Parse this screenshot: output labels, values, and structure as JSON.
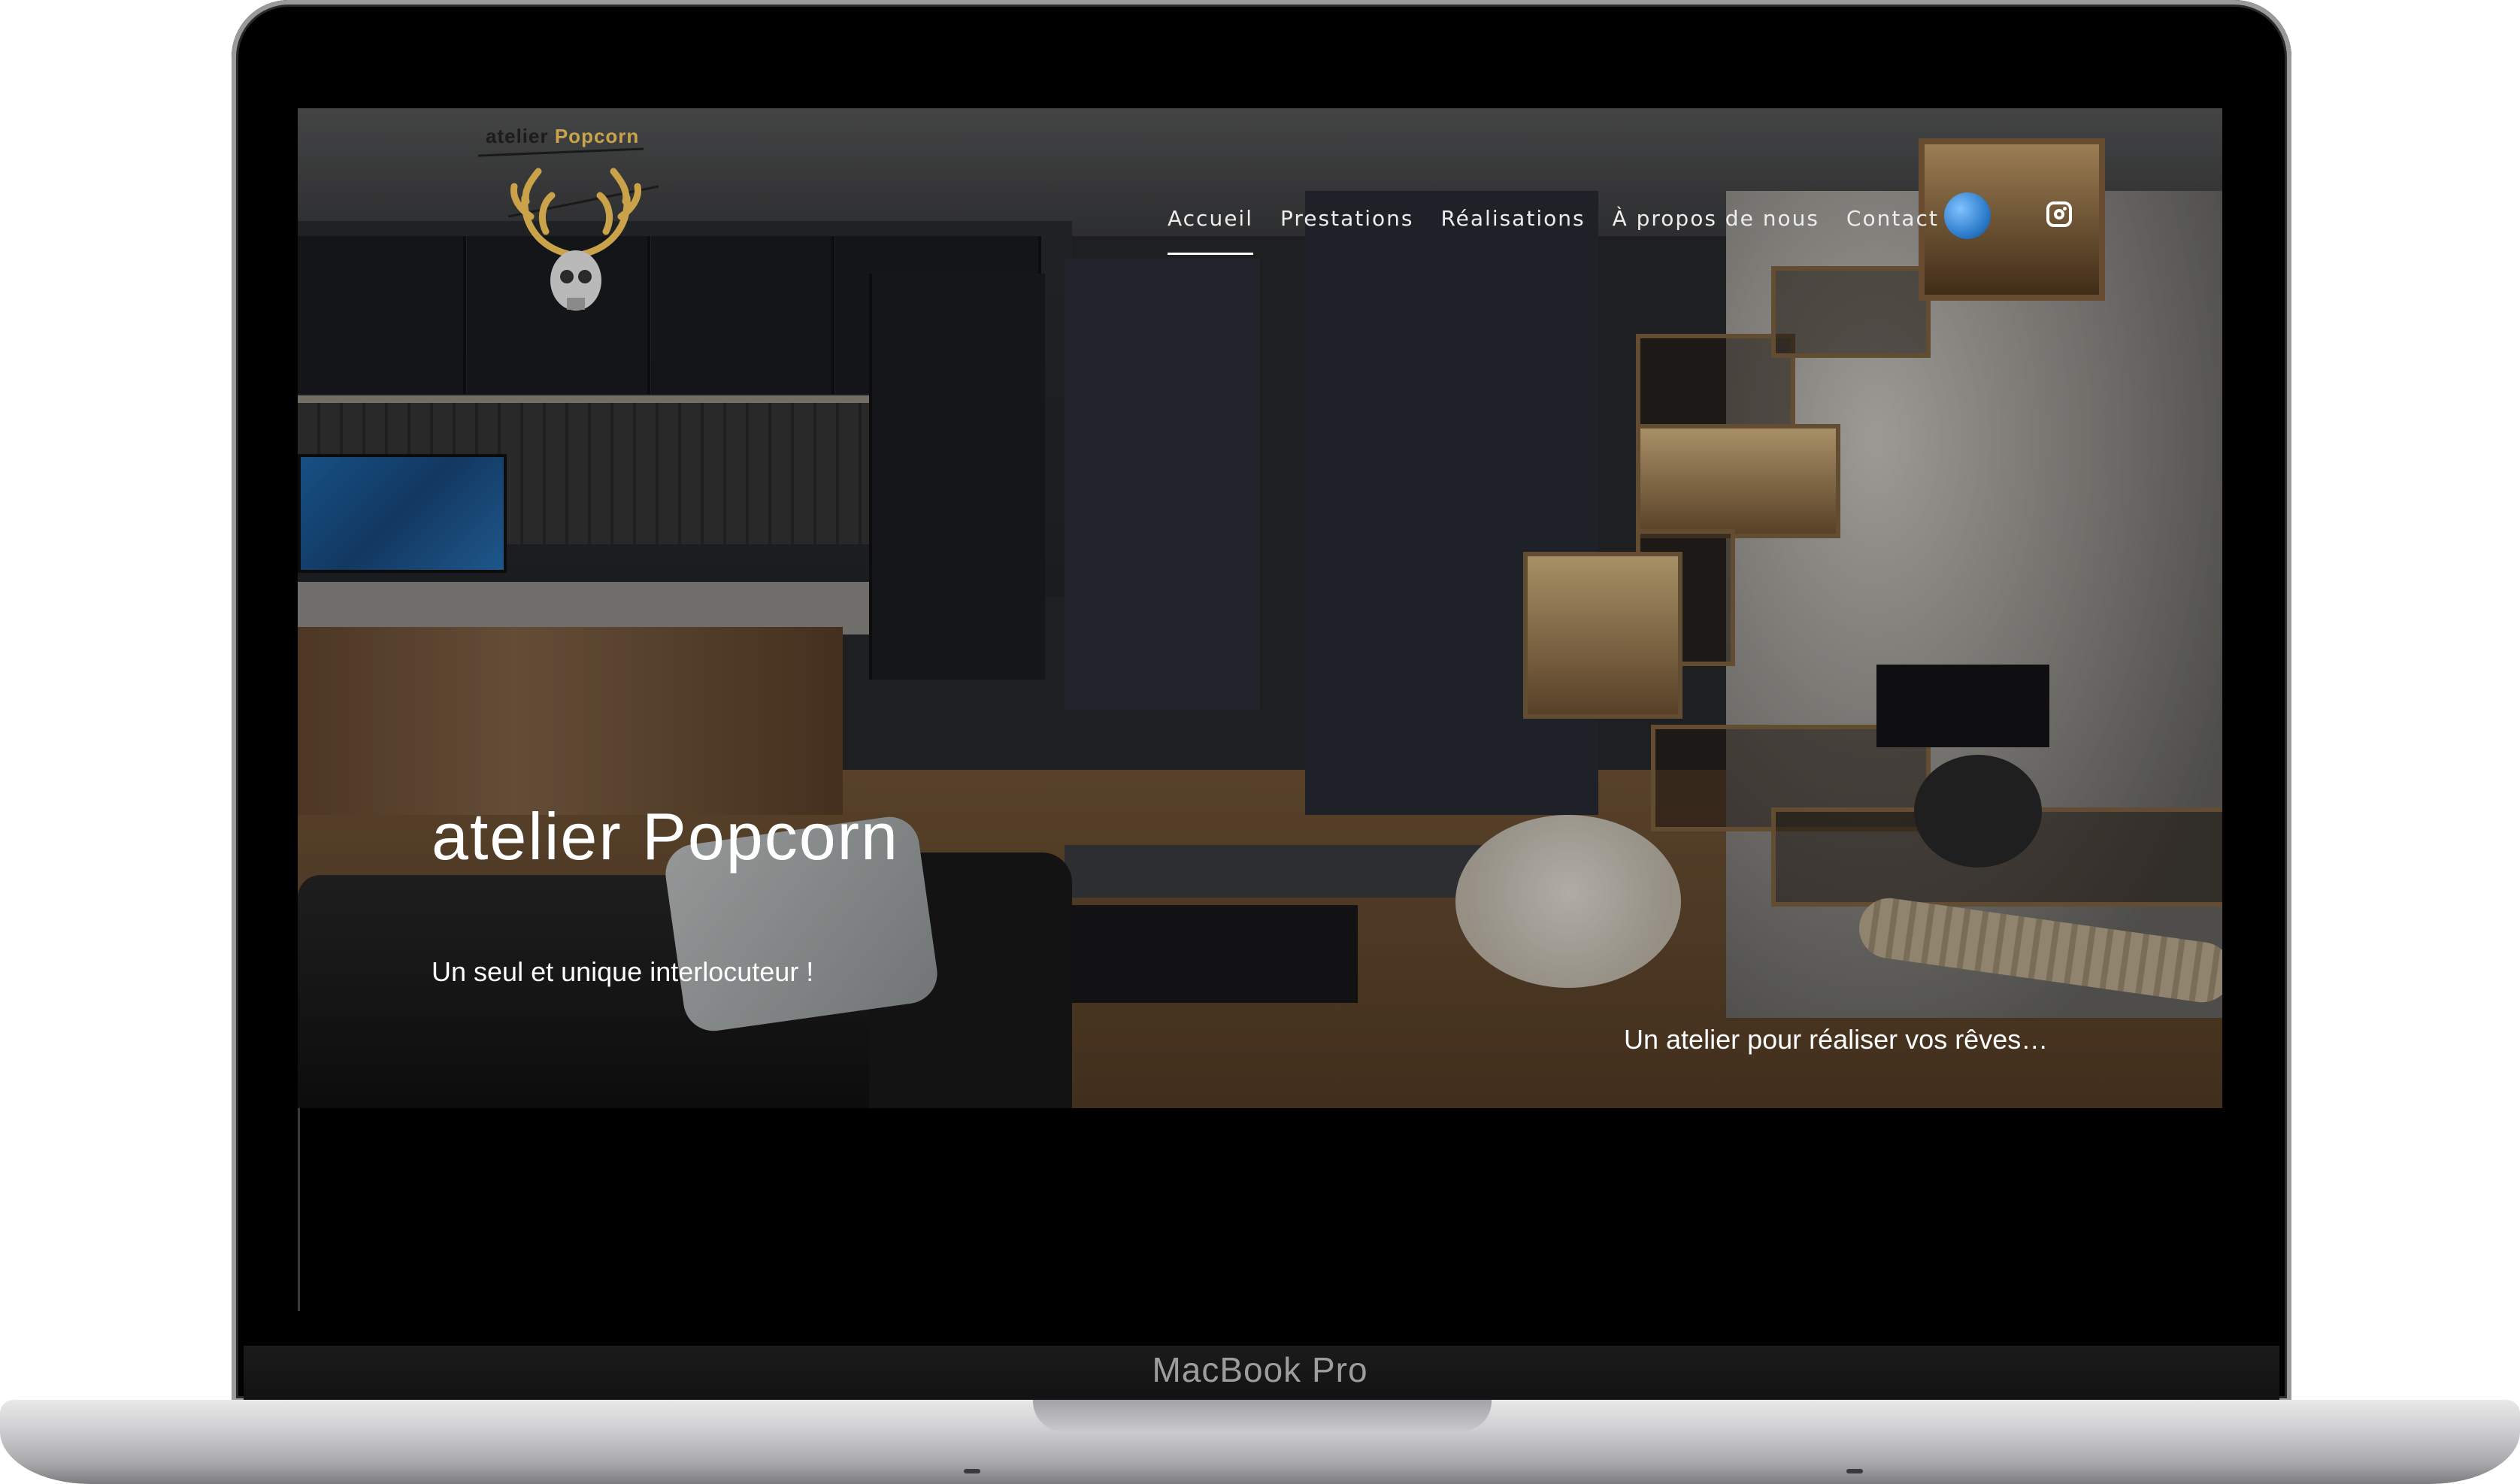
{
  "device": {
    "model_label": "MacBook Pro"
  },
  "site": {
    "logo_text_primary": "atelier",
    "logo_text_accent": "Popcorn",
    "nav": [
      {
        "label": "Accueil",
        "active": true
      },
      {
        "label": "Prestations",
        "active": false
      },
      {
        "label": "Réalisations",
        "active": false
      },
      {
        "label": "À propos de nous",
        "active": false
      },
      {
        "label": "Contact",
        "active": false
      }
    ],
    "icons": {
      "globe": "globe-icon",
      "instagram": "instagram-icon"
    }
  },
  "hero": {
    "title": "atelier Popcorn",
    "subtitle": "Un seul et unique interlocuteur !",
    "tagline": "Un atelier pour réaliser vos rêves…"
  },
  "colors": {
    "accent_gold": "#caa44a",
    "nav_text": "#ececec",
    "hero_text": "#ffffff"
  }
}
